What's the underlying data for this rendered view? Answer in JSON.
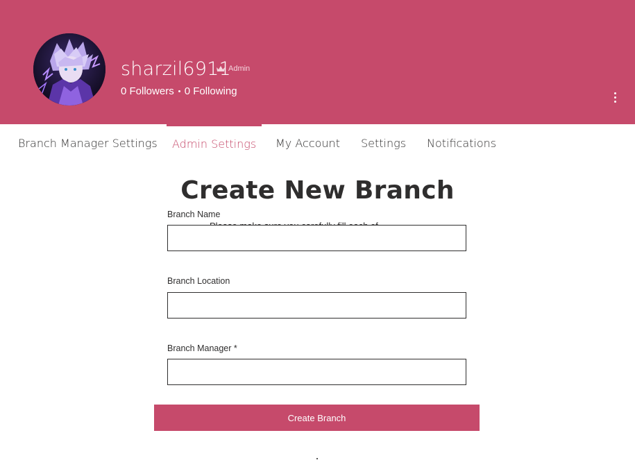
{
  "profile": {
    "username": "sharzil6911",
    "role": "Admin",
    "role_icon": "crown-icon",
    "followers": "0 Followers",
    "following": "0 Following",
    "more_icon": "vertical-ellipsis-icon"
  },
  "tabs": [
    {
      "label": "Branch Manager Settings",
      "active": false
    },
    {
      "label": "Admin Settings",
      "active": true
    },
    {
      "label": "My Account",
      "active": false
    },
    {
      "label": "Settings",
      "active": false
    },
    {
      "label": "Notifications",
      "active": false
    }
  ],
  "form": {
    "title": "Create New Branch",
    "hint_text": "Please make sure you carefully fill each of",
    "fields": [
      {
        "label": "Branch Name",
        "value": ""
      },
      {
        "label": "Branch Location",
        "value": ""
      },
      {
        "label": "Branch Manager *",
        "value": ""
      }
    ],
    "submit_label": "Create Branch"
  },
  "colors": {
    "accent": "#c64a6b",
    "text": "#2f2e2e",
    "background": "#ffffff"
  }
}
